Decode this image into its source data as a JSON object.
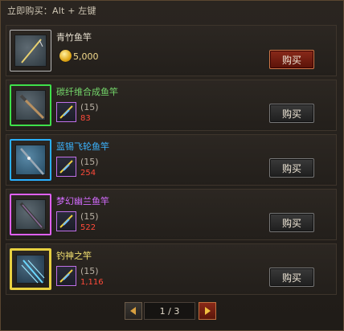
{
  "header": {
    "hint": "立即购买：Alt + 左键"
  },
  "currency": {
    "coin_icon": "gold-coin-icon"
  },
  "items": [
    {
      "name": "青竹鱼竿",
      "name_color": "#e6dfcf",
      "frame_color": "#b8b8b8",
      "price": "5,000",
      "material_count": "",
      "material_need": "",
      "buy_label": "购买",
      "buy_style": "red",
      "icon": "bamboo-rod-icon"
    },
    {
      "name": "碳纤维合成鱼竿",
      "name_color": "#74d66a",
      "frame_color": "#3ee04a",
      "price": "",
      "material_count": "(15)",
      "material_need": "83",
      "buy_label": "购买",
      "buy_style": "dark",
      "icon": "carbon-rod-icon"
    },
    {
      "name": "蓝锡飞轮鱼竿",
      "name_color": "#3cb4ff",
      "frame_color": "#2ab0ff",
      "price": "",
      "material_count": "(15)",
      "material_need": "254",
      "buy_label": "购买",
      "buy_style": "dark",
      "icon": "tin-reel-rod-icon"
    },
    {
      "name": "梦幻幽兰鱼竿",
      "name_color": "#d46cff",
      "frame_color": "#e060ff",
      "price": "",
      "material_count": "(15)",
      "material_need": "522",
      "buy_label": "购买",
      "buy_style": "dark",
      "icon": "dream-orchid-rod-icon"
    },
    {
      "name": "钓神之竿",
      "name_color": "#f2e070",
      "frame_color": "#e8d040",
      "price": "",
      "material_count": "(15)",
      "material_need": "1,116",
      "buy_label": "购买",
      "buy_style": "dark",
      "icon": "fishing-god-rod-icon"
    }
  ],
  "pager": {
    "page_text": "1 / 3",
    "prev_icon": "prev-arrow-icon",
    "next_icon": "next-arrow-icon"
  }
}
